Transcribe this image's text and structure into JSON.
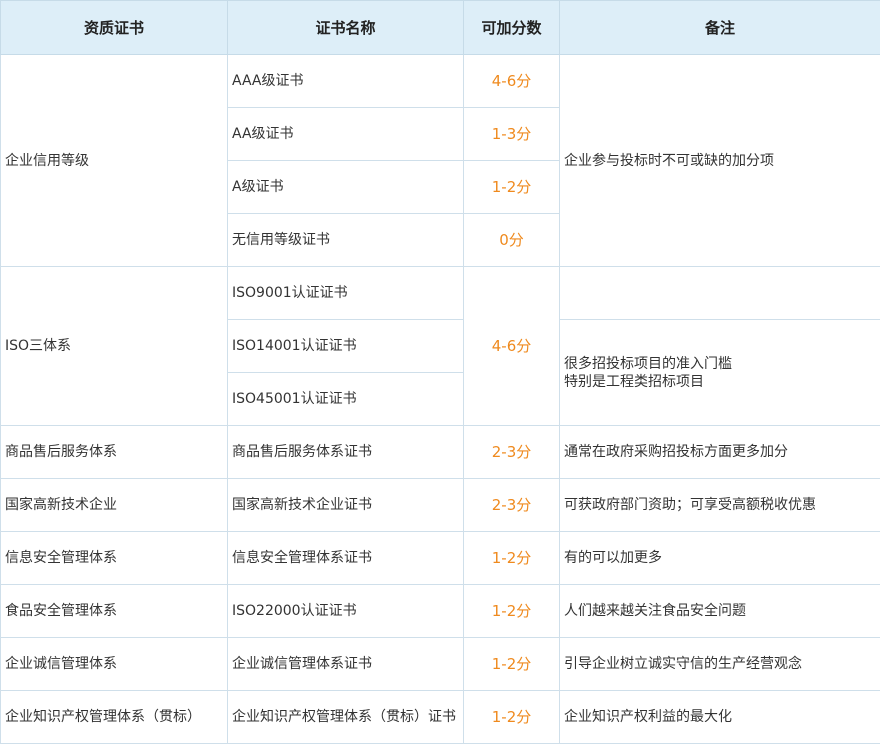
{
  "headers": [
    "资质证书",
    "证书名称",
    "可加分数",
    "备注"
  ],
  "groups": {
    "credit": {
      "category": "企业信用等级",
      "note": "企业参与投标时不可或缺的加分项",
      "items": [
        {
          "name": "AAA级证书",
          "score": "4-6分"
        },
        {
          "name": "AA级证书",
          "score": "1-3分"
        },
        {
          "name": "A级证书",
          "score": "1-2分"
        },
        {
          "name": "无信用等级证书",
          "score": "0分"
        }
      ]
    },
    "iso": {
      "category": "ISO三体系",
      "score": "4-6分",
      "note_line1": "很多招投标项目的准入门槛",
      "note_line2": "特别是工程类招标项目",
      "items": [
        {
          "name": "ISO9001认证证书"
        },
        {
          "name": "ISO14001认证证书"
        },
        {
          "name": "ISO45001认证证书"
        }
      ]
    }
  },
  "rows": [
    {
      "category": "商品售后服务体系",
      "name": "商品售后服务体系证书",
      "score": "2-3分",
      "note": "通常在政府采购招投标方面更多加分"
    },
    {
      "category": "国家高新技术企业",
      "name": "国家高新技术企业证书",
      "score": "2-3分",
      "note": "可获政府部门资助；可享受高额税收优惠"
    },
    {
      "category": "信息安全管理体系",
      "name": "信息安全管理体系证书",
      "score": "1-2分",
      "note": "有的可以加更多"
    },
    {
      "category": "食品安全管理体系",
      "name": "ISO22000认证证书",
      "score": "1-2分",
      "note": "人们越来越关注食品安全问题"
    },
    {
      "category": "企业诚信管理体系",
      "name": "企业诚信管理体系证书",
      "score": "1-2分",
      "note": "引导企业树立诚实守信的生产经营观念"
    },
    {
      "category": "企业知识产权管理体系（贯标）",
      "name": "企业知识产权管理体系（贯标）证书",
      "score": "1-2分",
      "note": "企业知识产权利益的最大化"
    }
  ],
  "colors": {
    "header_bg": "#ddeef8",
    "score": "#ef8a1e",
    "border": "#cfdfea"
  }
}
